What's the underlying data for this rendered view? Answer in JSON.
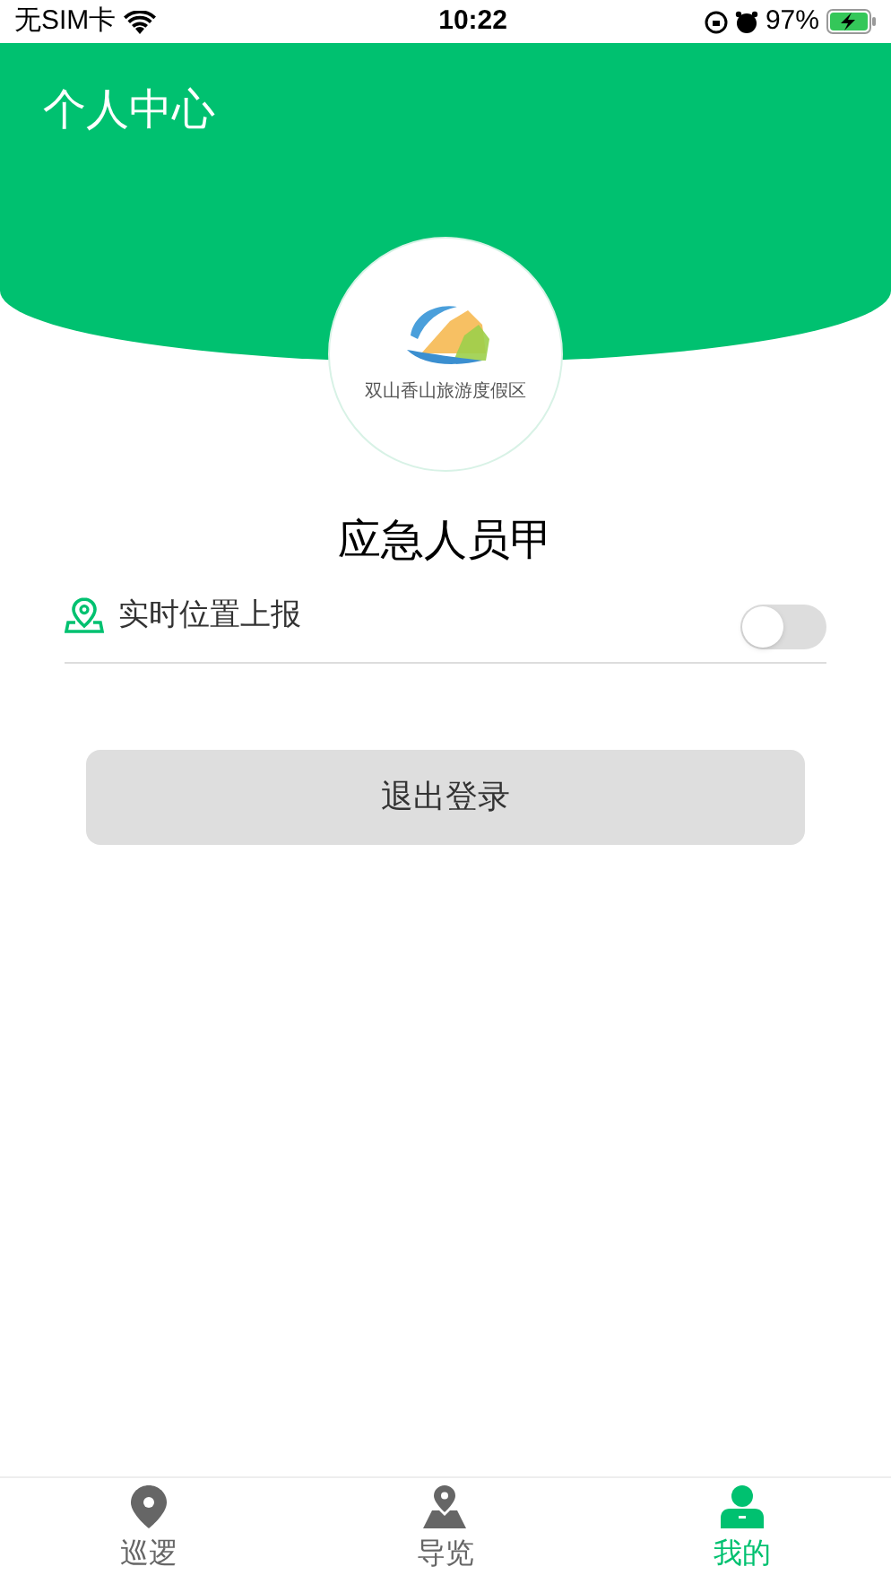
{
  "status_bar": {
    "carrier": "无SIM卡",
    "time": "10:22",
    "battery": "97%"
  },
  "header": {
    "title": "个人中心"
  },
  "logo": {
    "caption": "双山香山旅游度假区"
  },
  "user": {
    "name": "应急人员甲"
  },
  "settings": [
    {
      "label": "实时位置上报",
      "on": false
    }
  ],
  "logout": {
    "label": "退出登录"
  },
  "tabs": [
    {
      "label": "巡逻",
      "kind": "pin",
      "selected": false
    },
    {
      "label": "导览",
      "kind": "map",
      "selected": false
    },
    {
      "label": "我的",
      "kind": "person",
      "selected": true
    }
  ]
}
